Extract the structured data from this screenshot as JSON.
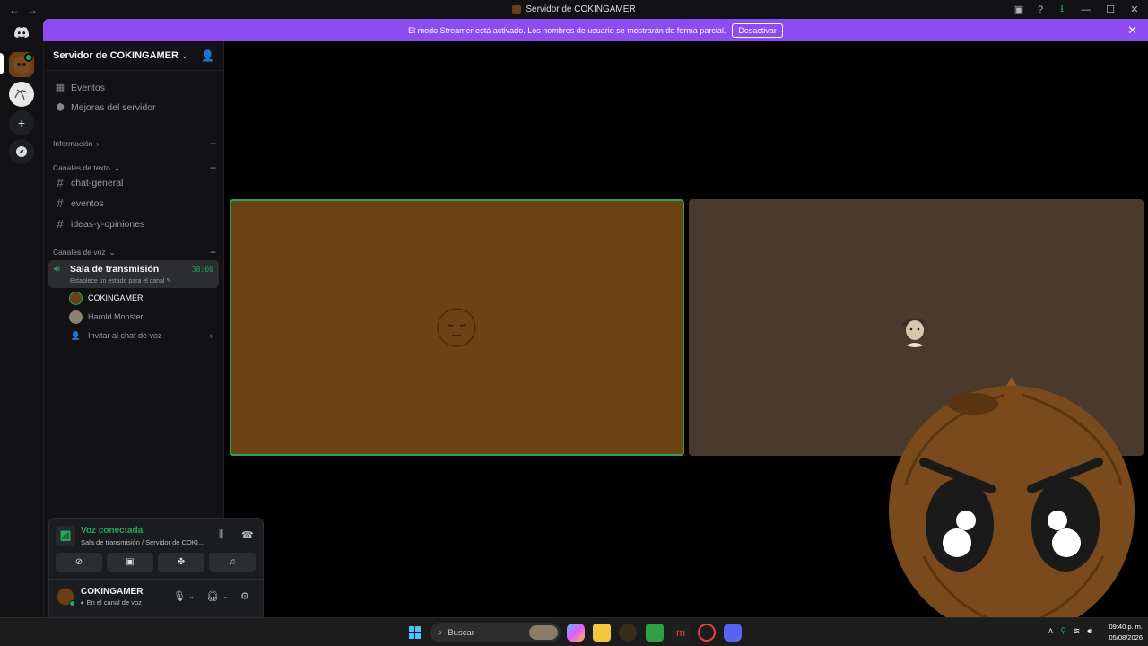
{
  "window": {
    "title": "Servidor de COKINGAMER"
  },
  "banner": {
    "text": "El modo Streamer está activado. Los nombres de usuario se mostrarán de forma parcial.",
    "button": "Desactivar"
  },
  "sidebar": {
    "server_name": "Servidor de COKINGAMER",
    "top_items": [
      {
        "label": "Eventos",
        "icon": "calendar-icon"
      },
      {
        "label": "Mejoras del servidor",
        "icon": "boost-icon"
      }
    ],
    "categories": {
      "info": "Información",
      "text": "Canales de texto",
      "voice": "Canales de voz"
    },
    "text_channels": [
      "chat-general",
      "eventos",
      "ideas-y-opiniones"
    ],
    "voice_channel": {
      "name": "Sala de transmisión",
      "timer": "38:00",
      "status": "Establece un estado para el canal"
    },
    "members": [
      "COKINGAMER",
      "Harold Monster"
    ],
    "invite": "Invitar al chat de voz"
  },
  "voice_panel": {
    "title": "Voz conectada",
    "subtitle": "Sala de transmisión / Servidor de COKI...",
    "user": {
      "name": "COKINGAMER",
      "status": "En el canal de voz"
    }
  },
  "taskbar": {
    "search_placeholder": "Buscar",
    "time": "09:40 p. m.",
    "date": "05/08/2026"
  },
  "colors": {
    "accent_green": "#23a55a",
    "streamer_banner": "#8d4cf2",
    "tile1_bg": "#6e4214",
    "tile2_bg": "#493a2c"
  }
}
